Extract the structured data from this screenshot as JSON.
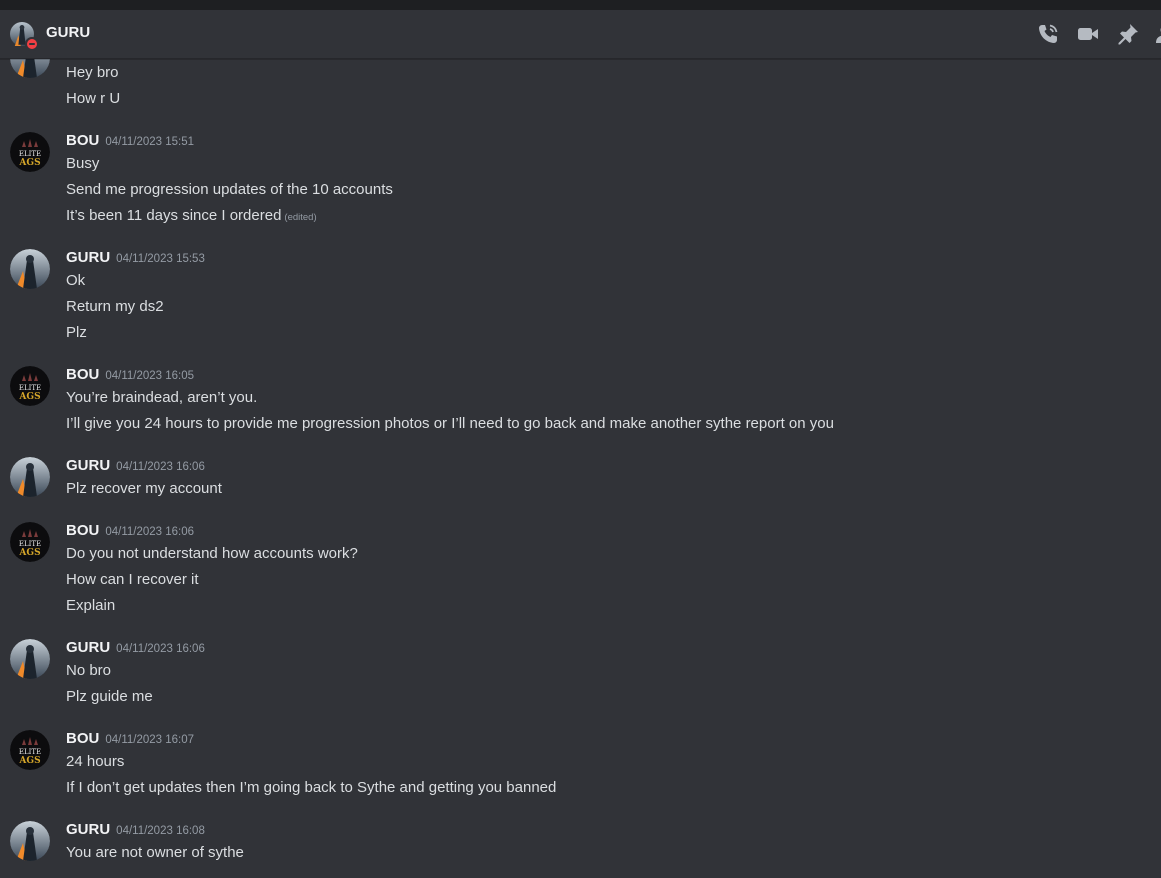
{
  "header": {
    "title": "GURU",
    "icons": [
      "phone-call-icon",
      "video-icon",
      "pin-icon",
      "member-list-icon"
    ]
  },
  "messages": [
    {
      "author": "",
      "timestamp": "",
      "avatar": "guru",
      "lines": [
        "Hey bro",
        "How r U"
      ]
    },
    {
      "author": "BOU",
      "timestamp": "04/11/2023 15:51",
      "avatar": "bou",
      "lines": [
        "Busy",
        "Send me progression updates of the 10 accounts",
        "It’s been 11 days since I ordered"
      ],
      "edited_label": "(edited)"
    },
    {
      "author": "GURU",
      "timestamp": "04/11/2023 15:53",
      "avatar": "guru",
      "lines": [
        "Ok",
        "Return my ds2",
        "Plz"
      ]
    },
    {
      "author": "BOU",
      "timestamp": "04/11/2023 16:05",
      "avatar": "bou",
      "lines": [
        "You’re braindead, aren’t you.",
        "I’ll give you 24 hours to provide me progression photos or I’ll need to go back and make another sythe report on you"
      ]
    },
    {
      "author": "GURU",
      "timestamp": "04/11/2023 16:06",
      "avatar": "guru",
      "lines": [
        "Plz recover my account"
      ]
    },
    {
      "author": "BOU",
      "timestamp": "04/11/2023 16:06",
      "avatar": "bou",
      "lines": [
        "Do you not understand how accounts work?",
        "How can I recover it",
        "Explain"
      ]
    },
    {
      "author": "GURU",
      "timestamp": "04/11/2023 16:06",
      "avatar": "guru",
      "lines": [
        "No bro",
        "Plz guide me"
      ]
    },
    {
      "author": "BOU",
      "timestamp": "04/11/2023 16:07",
      "avatar": "bou",
      "lines": [
        "24 hours",
        "If I don’t get updates then I’m going back to Sythe and getting you banned"
      ]
    },
    {
      "author": "GURU",
      "timestamp": "04/11/2023 16:08",
      "avatar": "guru",
      "lines": [
        "You are not owner  of sythe"
      ]
    }
  ],
  "bou_avatar_text": {
    "top": "ELITE",
    "bottom": "AGS"
  },
  "colors": {
    "background": "#313338",
    "header_bar": "#1e1f22",
    "username": "#f2f3f5",
    "message_text": "#dbdee1",
    "timestamp": "#949ba4",
    "dnd_status": "#f23f43",
    "bou_text_gold": "#d4a52a"
  }
}
